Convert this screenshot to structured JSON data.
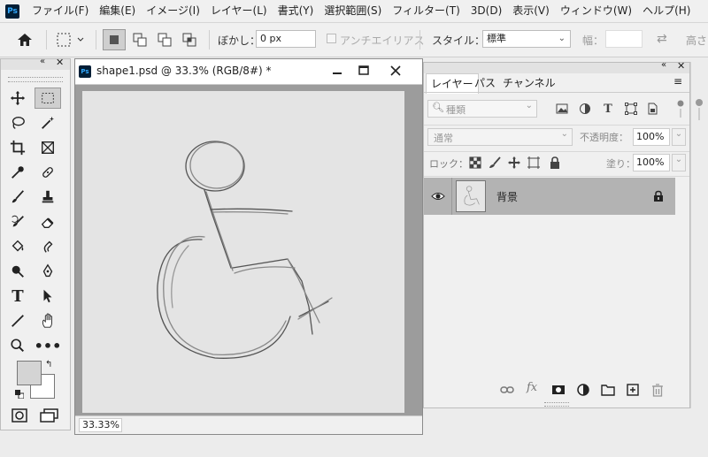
{
  "menu": {
    "logo": "Ps",
    "items": [
      "ファイル(F)",
      "編集(E)",
      "イメージ(I)",
      "レイヤー(L)",
      "書式(Y)",
      "選択範囲(S)",
      "フィルター(T)",
      "3D(D)",
      "表示(V)",
      "ウィンドウ(W)",
      "ヘルプ(H)"
    ]
  },
  "options": {
    "feather_label": "ぼかし：",
    "feather_value": "0 px",
    "antialias_label": "アンチエイリアス",
    "style_label": "スタイル：",
    "style_value": "標準",
    "width_label": "幅：",
    "height_label": "高さ"
  },
  "document": {
    "title": "shape1.psd @ 33.3% (RGB/8#) *",
    "zoom": "33.33%"
  },
  "layers_panel": {
    "tabs": [
      "レイヤー",
      "パス",
      "チャンネル"
    ],
    "kind_placeholder": "種類",
    "blend_mode": "通常",
    "opacity_label": "不透明度：",
    "opacity_value": "100%",
    "lock_label": "ロック：",
    "fill_label": "塗り：",
    "fill_value": "100%",
    "layers": [
      {
        "name": "背景"
      }
    ]
  },
  "colors": {
    "accent": "#31a8ff",
    "layer_selected": "#b3b3b3"
  }
}
